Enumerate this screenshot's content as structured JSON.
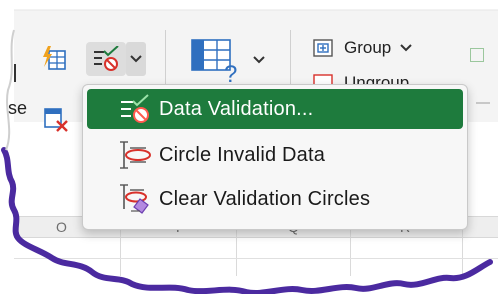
{
  "ribbon": {
    "partial_label": "se",
    "group_label": "Group",
    "ungroup_label": "Ungroup"
  },
  "columns": [
    "O",
    "P",
    "Q",
    "R"
  ],
  "menu": {
    "items": [
      {
        "label": "Data Validation...",
        "icon": "data-validation-icon",
        "selected": true
      },
      {
        "label": "Circle Invalid Data",
        "icon": "circle-invalid-data-icon",
        "selected": false
      },
      {
        "label": "Clear Validation Circles",
        "icon": "clear-validation-circles-icon",
        "selected": false
      }
    ]
  },
  "colors": {
    "accent": "#1e7b3d",
    "edge": "#4b2aa0"
  }
}
